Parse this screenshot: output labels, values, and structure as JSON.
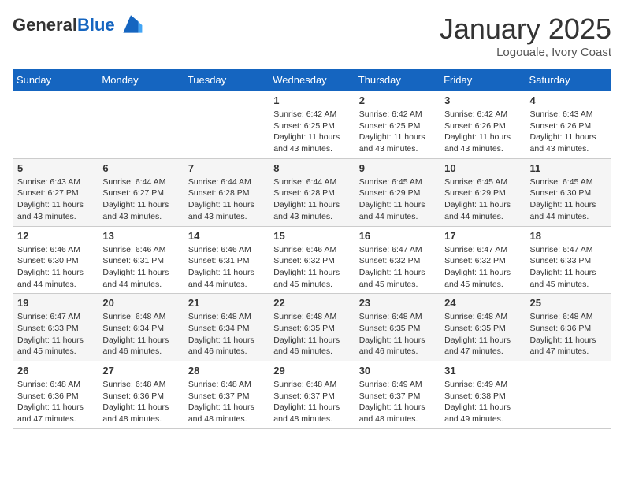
{
  "logo": {
    "line1": "General",
    "line2": "Blue"
  },
  "title": "January 2025",
  "location": "Logouale, Ivory Coast",
  "days_of_week": [
    "Sunday",
    "Monday",
    "Tuesday",
    "Wednesday",
    "Thursday",
    "Friday",
    "Saturday"
  ],
  "weeks": [
    [
      {
        "day": "",
        "info": ""
      },
      {
        "day": "",
        "info": ""
      },
      {
        "day": "",
        "info": ""
      },
      {
        "day": "1",
        "info": "Sunrise: 6:42 AM\nSunset: 6:25 PM\nDaylight: 11 hours and 43 minutes."
      },
      {
        "day": "2",
        "info": "Sunrise: 6:42 AM\nSunset: 6:25 PM\nDaylight: 11 hours and 43 minutes."
      },
      {
        "day": "3",
        "info": "Sunrise: 6:42 AM\nSunset: 6:26 PM\nDaylight: 11 hours and 43 minutes."
      },
      {
        "day": "4",
        "info": "Sunrise: 6:43 AM\nSunset: 6:26 PM\nDaylight: 11 hours and 43 minutes."
      }
    ],
    [
      {
        "day": "5",
        "info": "Sunrise: 6:43 AM\nSunset: 6:27 PM\nDaylight: 11 hours and 43 minutes."
      },
      {
        "day": "6",
        "info": "Sunrise: 6:44 AM\nSunset: 6:27 PM\nDaylight: 11 hours and 43 minutes."
      },
      {
        "day": "7",
        "info": "Sunrise: 6:44 AM\nSunset: 6:28 PM\nDaylight: 11 hours and 43 minutes."
      },
      {
        "day": "8",
        "info": "Sunrise: 6:44 AM\nSunset: 6:28 PM\nDaylight: 11 hours and 43 minutes."
      },
      {
        "day": "9",
        "info": "Sunrise: 6:45 AM\nSunset: 6:29 PM\nDaylight: 11 hours and 44 minutes."
      },
      {
        "day": "10",
        "info": "Sunrise: 6:45 AM\nSunset: 6:29 PM\nDaylight: 11 hours and 44 minutes."
      },
      {
        "day": "11",
        "info": "Sunrise: 6:45 AM\nSunset: 6:30 PM\nDaylight: 11 hours and 44 minutes."
      }
    ],
    [
      {
        "day": "12",
        "info": "Sunrise: 6:46 AM\nSunset: 6:30 PM\nDaylight: 11 hours and 44 minutes."
      },
      {
        "day": "13",
        "info": "Sunrise: 6:46 AM\nSunset: 6:31 PM\nDaylight: 11 hours and 44 minutes."
      },
      {
        "day": "14",
        "info": "Sunrise: 6:46 AM\nSunset: 6:31 PM\nDaylight: 11 hours and 44 minutes."
      },
      {
        "day": "15",
        "info": "Sunrise: 6:46 AM\nSunset: 6:32 PM\nDaylight: 11 hours and 45 minutes."
      },
      {
        "day": "16",
        "info": "Sunrise: 6:47 AM\nSunset: 6:32 PM\nDaylight: 11 hours and 45 minutes."
      },
      {
        "day": "17",
        "info": "Sunrise: 6:47 AM\nSunset: 6:32 PM\nDaylight: 11 hours and 45 minutes."
      },
      {
        "day": "18",
        "info": "Sunrise: 6:47 AM\nSunset: 6:33 PM\nDaylight: 11 hours and 45 minutes."
      }
    ],
    [
      {
        "day": "19",
        "info": "Sunrise: 6:47 AM\nSunset: 6:33 PM\nDaylight: 11 hours and 45 minutes."
      },
      {
        "day": "20",
        "info": "Sunrise: 6:48 AM\nSunset: 6:34 PM\nDaylight: 11 hours and 46 minutes."
      },
      {
        "day": "21",
        "info": "Sunrise: 6:48 AM\nSunset: 6:34 PM\nDaylight: 11 hours and 46 minutes."
      },
      {
        "day": "22",
        "info": "Sunrise: 6:48 AM\nSunset: 6:35 PM\nDaylight: 11 hours and 46 minutes."
      },
      {
        "day": "23",
        "info": "Sunrise: 6:48 AM\nSunset: 6:35 PM\nDaylight: 11 hours and 46 minutes."
      },
      {
        "day": "24",
        "info": "Sunrise: 6:48 AM\nSunset: 6:35 PM\nDaylight: 11 hours and 47 minutes."
      },
      {
        "day": "25",
        "info": "Sunrise: 6:48 AM\nSunset: 6:36 PM\nDaylight: 11 hours and 47 minutes."
      }
    ],
    [
      {
        "day": "26",
        "info": "Sunrise: 6:48 AM\nSunset: 6:36 PM\nDaylight: 11 hours and 47 minutes."
      },
      {
        "day": "27",
        "info": "Sunrise: 6:48 AM\nSunset: 6:36 PM\nDaylight: 11 hours and 48 minutes."
      },
      {
        "day": "28",
        "info": "Sunrise: 6:48 AM\nSunset: 6:37 PM\nDaylight: 11 hours and 48 minutes."
      },
      {
        "day": "29",
        "info": "Sunrise: 6:48 AM\nSunset: 6:37 PM\nDaylight: 11 hours and 48 minutes."
      },
      {
        "day": "30",
        "info": "Sunrise: 6:49 AM\nSunset: 6:37 PM\nDaylight: 11 hours and 48 minutes."
      },
      {
        "day": "31",
        "info": "Sunrise: 6:49 AM\nSunset: 6:38 PM\nDaylight: 11 hours and 49 minutes."
      },
      {
        "day": "",
        "info": ""
      }
    ]
  ]
}
